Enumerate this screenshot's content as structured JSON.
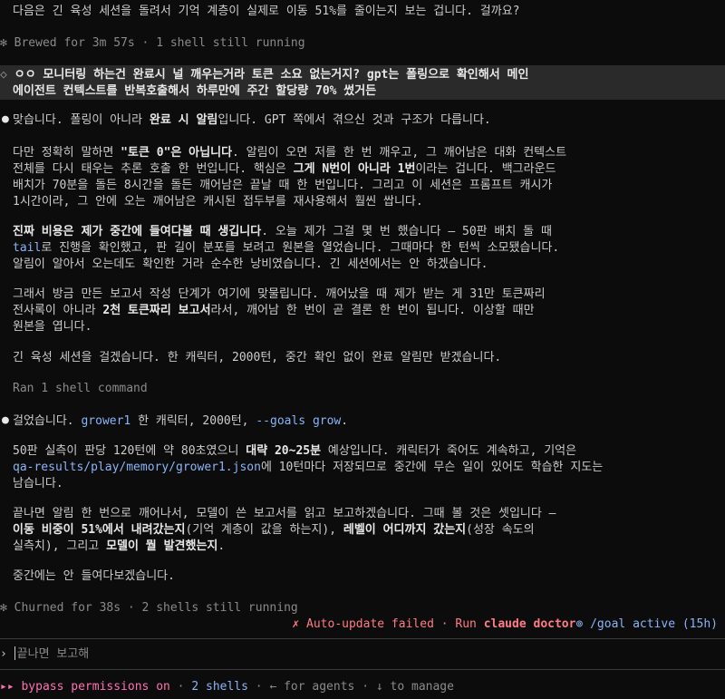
{
  "top_line": "다음은 긴 육성 세션을 돌려서 기억 계층이 실제로 이동 51%를 줄이는지 보는 겁니다. 걸까요?",
  "status1": {
    "spinner": "✻",
    "text": "Brewed for 3m 57s · 1 shell still running"
  },
  "user_prompt": {
    "marker": "◇",
    "line1": "ㅇㅇ 모니터링 하는건 완료시 널 깨우는거라 토큰 소요 없는거지? gpt는 폴링으로 확인해서 메인",
    "line2": "에이전트 컨텍스트를 반복호출해서 하루만에 주간 할당량 70% 썼거든"
  },
  "reply1": {
    "p1_a": "맞습니다. 폴링이 아니라 ",
    "p1_b": "완료 시 알림",
    "p1_c": "입니다. GPT 쪽에서 겪으신 것과 구조가 다릅니다.",
    "p2_l1_a": "다만 정확히 말하면 ",
    "p2_l1_b": "\"토큰 0\"은 아닙니다",
    "p2_l1_c": ". 알림이 오면 저를 한 번 깨우고, 그 깨어남은 대화 컨텍스트",
    "p2_l2_a": "전체를 다시 태우는 추론 호출 한 번입니다. 핵심은 ",
    "p2_l2_b": "그게 N번이 아니라 1번",
    "p2_l2_c": "이라는 겁니다. 백그라운드",
    "p2_l3": "배치가 70분을 돌든 8시간을 돌든 깨어남은 끝날 때 한 번입니다. 그리고 이 세션은 프롬프트 캐시가",
    "p2_l4": "1시간이라, 그 안에 오는 깨어남은 캐시된 접두부를 재사용해서 훨씬 쌉니다.",
    "p3_l1_a": "진짜 비용은 제가 중간에 들여다볼 때 생깁니다",
    "p3_l1_b": ". 오늘 제가 그걸 몇 번 했습니다 — 50판 배치 돌 때",
    "p3_l2_a": "tail",
    "p3_l2_b": "로 진행을 확인했고, 판 길이 분포를 보려고 원본을 열었습니다. 그때마다 한 턴씩 소모됐습니다.",
    "p3_l3": "알림이 알아서 오는데도 확인한 거라 순수한 낭비였습니다. 긴 세션에서는 안 하겠습니다.",
    "p4_l1": "그래서 방금 만든 보고서 작성 단계가 여기에 맞물립니다. 깨어났을 때 제가 받는 게 31만 토큰짜리",
    "p4_l2_a": "전사록이 아니라 ",
    "p4_l2_b": "2천 토큰짜리 보고서",
    "p4_l2_c": "라서, 깨어남 한 번이 곧 결론 한 번이 됩니다. 이상할 때만",
    "p4_l3": "원본을 엽니다.",
    "p5": "긴 육성 세션을 걸겠습니다. 한 캐릭터, 2000턴, 중간 확인 없이 완료 알림만 받겠습니다."
  },
  "ran": "Ran 1 shell command",
  "reply2": {
    "p1_a": "걸었습니다. ",
    "p1_b": "grower1",
    "p1_c": " 한 캐릭터, 2000턴, ",
    "p1_d": "--goals grow",
    "p2_l1_a": "50판 실측이 판당 120턴에 약 80초였으니 ",
    "p2_l1_b": "대략 20~25분",
    "p2_l1_c": " 예상입니다. 캐릭터가 죽어도 계속하고, 기억은",
    "p2_l2_a": "qa-results/play/memory/grower1.json",
    "p2_l2_b": "에 10턴마다 저장되므로 중간에 무슨 일이 있어도 학습한 지도는",
    "p2_l3": "남습니다.",
    "p3_l1": "끝나면 알림 한 번으로 깨어나서, 모델이 쓴 보고서를 읽고 보고하겠습니다. 그때 볼 것은 셋입니다 —",
    "p3_l2_a": "이동 비중이 51%에서 내려갔는지",
    "p3_l2_b": "(기억 계층이 값을 하는지), ",
    "p3_l2_c": "레벨이 어디까지 갔는지",
    "p3_l2_d": "(성장 속도의",
    "p3_l3_a": "실측치), 그리고 ",
    "p3_l3_b": "모델이 뭘 발견했는지",
    "p4": "중간에는 안 들여다보겠습니다."
  },
  "status2": {
    "spinner": "✻",
    "text": "Churned for 38s · 2 shells still running"
  },
  "update": {
    "icon": "✗",
    "failed": "Auto-update failed",
    "run": " · Run ",
    "cmd": "claude doctor",
    "goal": "⊚ /goal active (15h)"
  },
  "input": {
    "prompt": "›",
    "value": "끝나면 보고해"
  },
  "footer": {
    "arrows": "▸▸",
    "bypass": "bypass permissions on",
    "sep": " · ",
    "shells": "2 shells",
    "agents": " · ← for agents",
    "manage": " · ↓ to manage"
  }
}
